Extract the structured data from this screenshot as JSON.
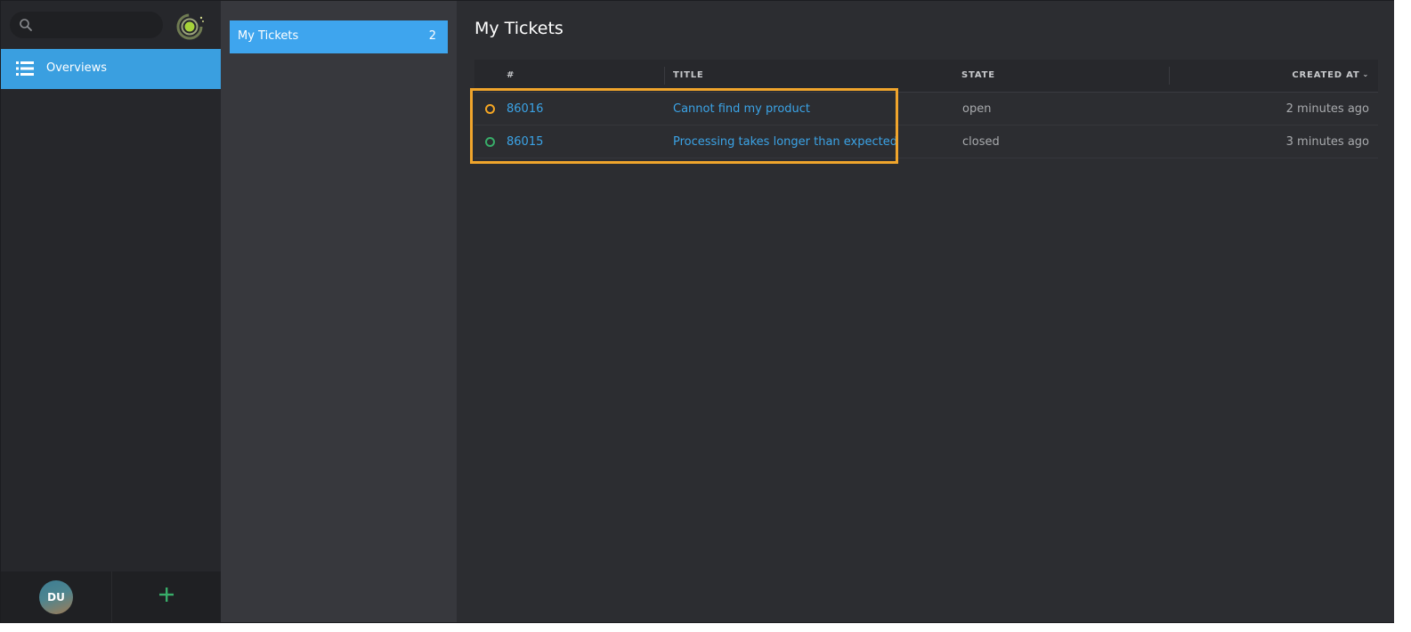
{
  "search": {
    "placeholder": ""
  },
  "nav": {
    "items": [
      {
        "label": "Overviews",
        "icon": "list-icon"
      }
    ]
  },
  "footer": {
    "avatar_initials": "DU",
    "add_icon": "plus-icon"
  },
  "overviews": [
    {
      "label": "My Tickets",
      "count": "2"
    }
  ],
  "main": {
    "title": "My Tickets",
    "columns": {
      "number": "#",
      "title": "TITLE",
      "state": "STATE",
      "created_at": "CREATED AT"
    },
    "rows": [
      {
        "number": "86016",
        "title": "Cannot find my product",
        "state": "open",
        "created_at": "2 minutes ago",
        "status_color": "#f5a623"
      },
      {
        "number": "86015",
        "title": "Processing takes longer than expected",
        "state": "closed",
        "created_at": "3 minutes ago",
        "status_color": "#38ad69"
      }
    ]
  },
  "colors": {
    "accent": "#3ea5ee",
    "highlight": "#f0a52c",
    "open": "#f5a623",
    "closed": "#38ad69"
  }
}
